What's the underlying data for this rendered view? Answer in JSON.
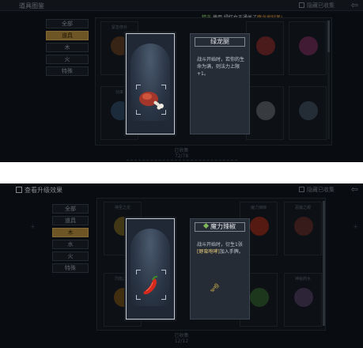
{
  "panel1": {
    "title": "道具图鉴",
    "hide_label": "隐藏已收集",
    "back_icon": "arrow-left-icon",
    "notice": {
      "tag": "精选",
      "prefix": "使用",
      "item": "绿红女王通关了",
      "suffix": "魔龙地狱果!"
    },
    "categories": [
      "全部",
      "道具",
      "木",
      "火",
      "特殊"
    ],
    "active_category": 1,
    "grid_names": [
      "紧急修补",
      "",
      "",
      "",
      "",
      "",
      "",
      "",
      "功率",
      "",
      "",
      "",
      "",
      "",
      "",
      "",
      ""
    ],
    "footer": {
      "label": "已收集",
      "count": "72/78"
    },
    "popup": {
      "item_icon": "meat-leg-icon",
      "title": "绿龙腿",
      "body": "战斗开始时，若你的生命为满，则法力上限+1。"
    }
  },
  "panel2": {
    "upgrade_label": "查看升级效果",
    "hide_label": "隐藏已收集",
    "back_icon": "arrow-left-icon",
    "categories": [
      "全部",
      "道具",
      "木",
      "水",
      "火",
      "特殊"
    ],
    "active_category": 2,
    "grid_names": [
      "神圣之花",
      "",
      "魔力辣椒",
      "",
      "恶魔之眼",
      "烈焰之牙",
      "",
      "",
      "",
      "神秘药水"
    ],
    "footer": {
      "label": "已收集",
      "count": "12/12"
    },
    "popup": {
      "item_icon": "chili-pepper-icon",
      "title": "魔力辣椒",
      "body_a": "战斗开始时，衍生1张",
      "body_em": "[野蛮咆哮]",
      "body_b": "加入手牌。",
      "key_icon": "key-icon"
    }
  },
  "colors": {
    "bg": "#0f141a",
    "accent": "#b08a3c",
    "card_border": "#c7ccd3"
  }
}
